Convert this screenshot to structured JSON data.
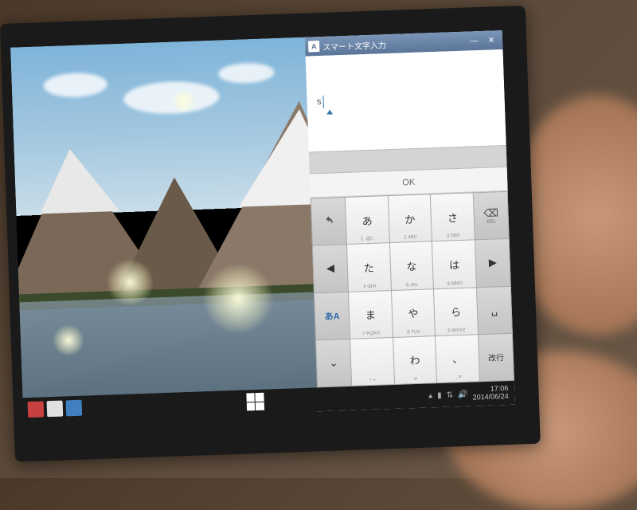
{
  "ime": {
    "title": "スマート文字入力",
    "title_icon": "A",
    "input_value": "s",
    "ok_label": "OK",
    "keys": {
      "row1": {
        "undo": "↶",
        "k1": {
          "main": "あ",
          "sub": "1 .@/.."
        },
        "k2": {
          "main": "か",
          "sub": "2 ABC"
        },
        "k3": {
          "main": "さ",
          "sub": "3 DEF"
        },
        "del": "DEL"
      },
      "row2": {
        "left": "◀",
        "k4": {
          "main": "た",
          "sub": "4 GHI"
        },
        "k5": {
          "main": "な",
          "sub": "5 JKL"
        },
        "k6": {
          "main": "は",
          "sub": "6 MNO"
        },
        "right": "▶"
      },
      "row3": {
        "mode": "あA",
        "k7": {
          "main": "ま",
          "sub": "7 PQRS"
        },
        "k8": {
          "main": "や",
          "sub": "8 TUV"
        },
        "k9": {
          "main": "ら",
          "sub": "9 WXYZ"
        },
        "space": "␣"
      },
      "row4": {
        "hide": "⌄",
        "k10": {
          "main": "　",
          "sub": "* +"
        },
        "k0": {
          "main": "わ",
          "sub": "0"
        },
        "k11": {
          "main": "、",
          "sub": ".,?!"
        },
        "enter": "改行"
      }
    }
  },
  "taskbar": {
    "time": "17:06",
    "date": "2014/06/24"
  }
}
